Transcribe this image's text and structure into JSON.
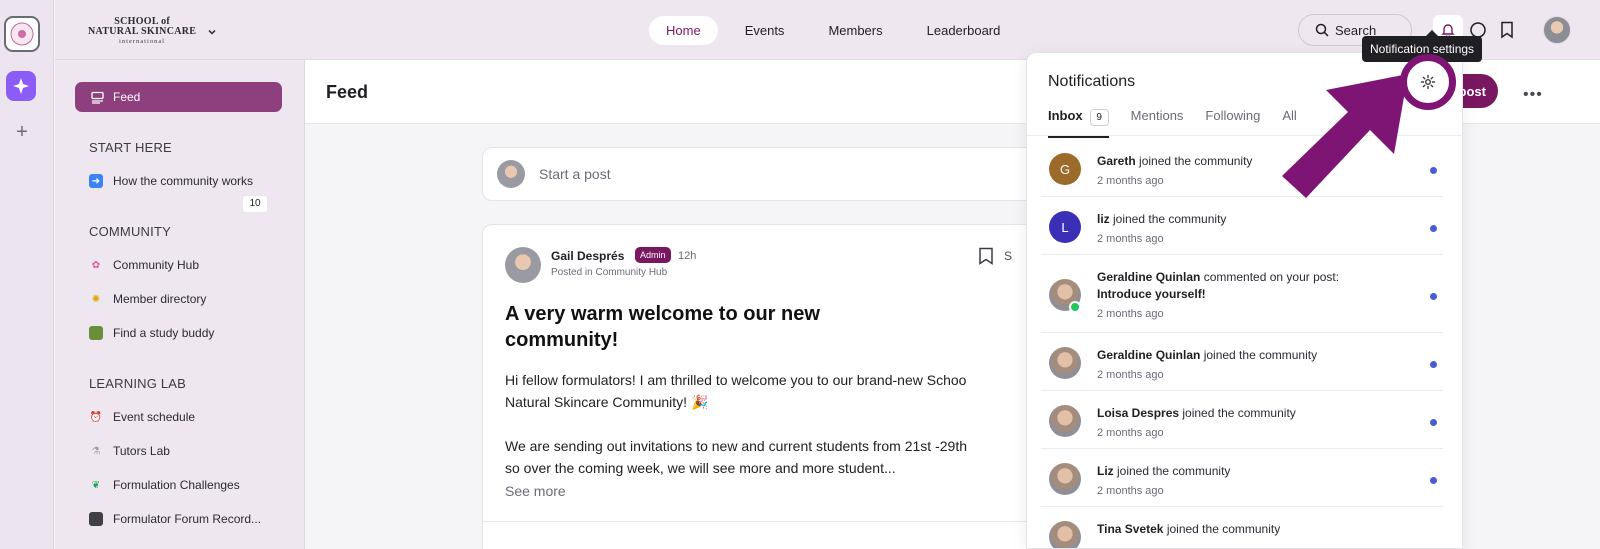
{
  "brand": {
    "line1": "SCHOOL of",
    "line2": "NATURAL SKINCARE",
    "line3": "international"
  },
  "topnav": [
    "Home",
    "Events",
    "Members",
    "Leaderboard"
  ],
  "search": {
    "label": "Search"
  },
  "sidebar": {
    "feed": "Feed",
    "sections": [
      {
        "heading": "START HERE",
        "items": [
          {
            "label": "How the community works",
            "icon": "arrow-right-icon"
          }
        ]
      },
      {
        "heading": "COMMUNITY",
        "items": [
          {
            "label": "Community Hub",
            "icon": "flower-icon",
            "badge": "10"
          },
          {
            "label": "Member directory",
            "icon": "sunflower-icon"
          },
          {
            "label": "Find a study buddy",
            "icon": "books-icon"
          }
        ]
      },
      {
        "heading": "LEARNING LAB",
        "items": [
          {
            "label": "Event schedule",
            "icon": "alarm-clock-icon"
          },
          {
            "label": "Tutors Lab",
            "icon": "test-tube-icon"
          },
          {
            "label": "Formulation Challenges",
            "icon": "seedling-icon"
          },
          {
            "label": "Formulator Forum Record...",
            "icon": "video-camera-icon"
          }
        ]
      }
    ]
  },
  "main": {
    "title": "Feed",
    "new_post": "ew post",
    "composer_placeholder": "Start a post",
    "post": {
      "author": "Gail Després",
      "role": "Admin",
      "time": "12h",
      "posted_in": "Posted in Community Hub",
      "share_cut": "S",
      "title": "A very warm welcome to our new community!",
      "body_1a": "Hi fellow formulators! I am thrilled to welcome you to our brand-new Schoo",
      "body_1b": "Natural Skincare Community! 🎉",
      "body_2a": "We are sending out invitations to new and current students from 21st -29th",
      "body_2b": "so over the coming week, we will see more and more student...",
      "see_more": "See more"
    }
  },
  "notifications": {
    "title": "Notifications",
    "tabs": [
      {
        "label": "Inbox",
        "count": "9"
      },
      {
        "label": "Mentions"
      },
      {
        "label": "Following"
      },
      {
        "label": "All"
      }
    ],
    "items": [
      {
        "initial": "G",
        "color": "#9c6a2a",
        "name": "Gareth",
        "action": " joined the community",
        "ago": "2 months ago"
      },
      {
        "initial": "L",
        "color": "#3b2fb8",
        "name": "liz",
        "action": " joined the community",
        "ago": "2 months ago"
      },
      {
        "name": "Geraldine Quinlan",
        "action": " commented on your post: ",
        "object": "Introduce yourself!",
        "ago": "2 months ago"
      },
      {
        "name": "Geraldine Quinlan",
        "action": " joined the community",
        "ago": "2 months ago"
      },
      {
        "name": "Loisa Despres",
        "action": " joined the community",
        "ago": "2 months ago"
      },
      {
        "name": "Liz",
        "action": " joined the community",
        "ago": "2 months ago"
      },
      {
        "name": "Tina Svetek",
        "action": " joined the community",
        "ago": ""
      }
    ]
  },
  "tooltip": "Notification settings",
  "colors": {
    "brand_accent": "#7a1761",
    "sidebar_active": "#8e3f7d",
    "annotation": "#7e1473",
    "unread_dot": "#4a5bd6"
  }
}
